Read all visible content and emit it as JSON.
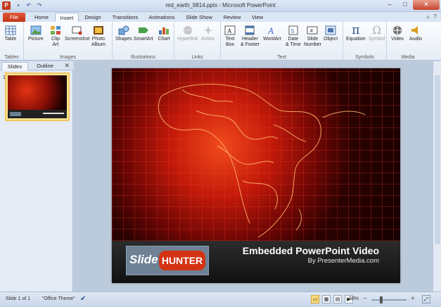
{
  "window": {
    "title": "red_earth_9814.pptx - Microsoft PowerPoint",
    "minimize": "–",
    "maximize": "□",
    "close": "✕"
  },
  "qat": {
    "save_icon": "save-icon",
    "undo_icon": "undo-icon",
    "redo_icon": "redo-icon"
  },
  "tabs": [
    {
      "label": "File"
    },
    {
      "label": "Home"
    },
    {
      "label": "Insert"
    },
    {
      "label": "Design"
    },
    {
      "label": "Transitions"
    },
    {
      "label": "Animations"
    },
    {
      "label": "Slide Show"
    },
    {
      "label": "Review"
    },
    {
      "label": "View"
    }
  ],
  "active_tab": "Insert",
  "ribbon": {
    "groups": [
      {
        "label": "Tables",
        "buttons": [
          {
            "label": "Table",
            "icon": "table-icon"
          }
        ]
      },
      {
        "label": "Images",
        "buttons": [
          {
            "label": "Picture",
            "icon": "picture-icon"
          },
          {
            "label": "Clip\nArt",
            "icon": "clip-art-icon"
          },
          {
            "label": "Screenshot",
            "icon": "screenshot-icon"
          },
          {
            "label": "Photo\nAlbum",
            "icon": "photo-album-icon"
          }
        ]
      },
      {
        "label": "Illustrations",
        "buttons": [
          {
            "label": "Shapes",
            "icon": "shapes-icon"
          },
          {
            "label": "SmartArt",
            "icon": "smartart-icon"
          },
          {
            "label": "Chart",
            "icon": "chart-icon"
          }
        ]
      },
      {
        "label": "Links",
        "buttons": [
          {
            "label": "Hyperlink",
            "icon": "hyperlink-icon",
            "disabled": true
          },
          {
            "label": "Action",
            "icon": "action-icon",
            "disabled": true
          }
        ]
      },
      {
        "label": "Text",
        "buttons": [
          {
            "label": "Text\nBox",
            "icon": "text-box-icon"
          },
          {
            "label": "Header\n& Footer",
            "icon": "header-footer-icon"
          },
          {
            "label": "WordArt",
            "icon": "wordart-icon"
          },
          {
            "label": "Date\n& Time",
            "icon": "date-time-icon"
          },
          {
            "label": "Slide\nNumber",
            "icon": "slide-number-icon"
          },
          {
            "label": "Object",
            "icon": "object-icon"
          }
        ]
      },
      {
        "label": "Symbols",
        "buttons": [
          {
            "label": "Equation",
            "icon": "equation-icon"
          },
          {
            "label": "Symbol",
            "icon": "symbol-icon",
            "disabled": true
          }
        ]
      },
      {
        "label": "Media",
        "buttons": [
          {
            "label": "Video",
            "icon": "video-icon"
          },
          {
            "label": "Audio",
            "icon": "audio-icon"
          }
        ]
      }
    ]
  },
  "pane": {
    "tabs": [
      "Slides",
      "Outline"
    ],
    "close": "✕",
    "slide_number": "1"
  },
  "slide": {
    "logo_slide": "Slide",
    "logo_hunter": "HUNTER",
    "title": "Embedded PowerPoint Video",
    "subtitle": "By PresenterMedia.com"
  },
  "status": {
    "slide_info": "Slide 1 of 1",
    "theme": "\"Office Theme\"",
    "zoom": "68%",
    "zoom_minus": "−",
    "zoom_plus": "+"
  },
  "colors": {
    "file_tab": "#c03418",
    "logo_hunter": "#d33312",
    "thumb_border": "#f3c55a"
  }
}
